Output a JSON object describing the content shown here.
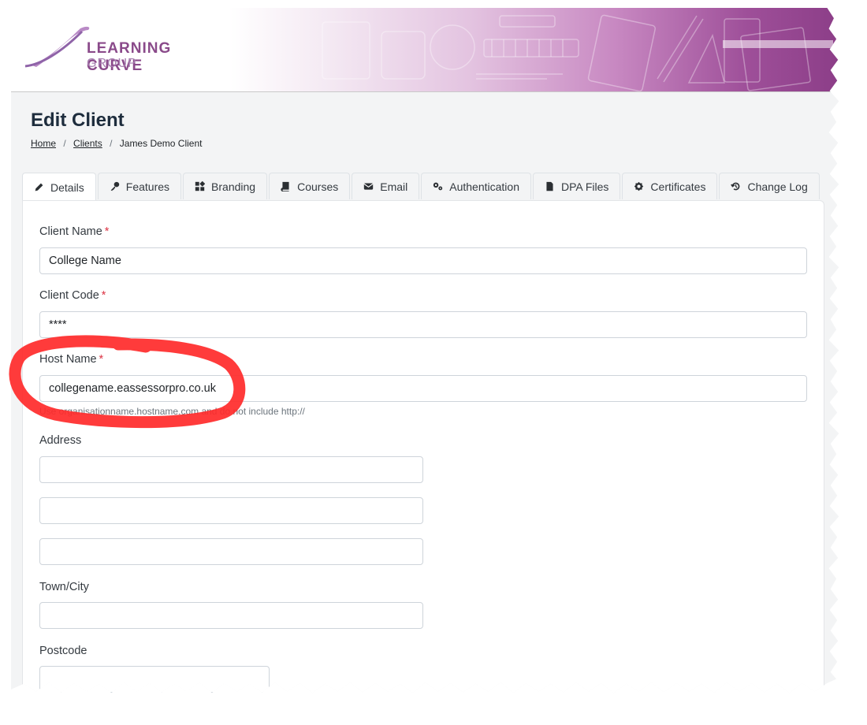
{
  "header": {
    "logo_line1": "LEARNING CURVE",
    "logo_line2": "GROUP",
    "brand_color": "#8a3c86"
  },
  "page": {
    "title": "Edit Client"
  },
  "breadcrumb": {
    "home": "Home",
    "clients": "Clients",
    "current": "James Demo Client",
    "separator": "/"
  },
  "tabs": [
    {
      "label": "Details",
      "icon": "pencil-icon",
      "active": true
    },
    {
      "label": "Features",
      "icon": "key-icon"
    },
    {
      "label": "Branding",
      "icon": "palette-icon"
    },
    {
      "label": "Courses",
      "icon": "book-icon"
    },
    {
      "label": "Email",
      "icon": "envelope-icon"
    },
    {
      "label": "Authentication",
      "icon": "gears-icon"
    },
    {
      "label": "DPA Files",
      "icon": "file-icon"
    },
    {
      "label": "Certificates",
      "icon": "certificate-icon"
    },
    {
      "label": "Change Log",
      "icon": "history-icon"
    }
  ],
  "form": {
    "required_marker": "*",
    "client_name": {
      "label": "Client Name",
      "value": "College Name"
    },
    "client_code": {
      "label": "Client Code",
      "value": "****"
    },
    "host_name": {
      "label": "Host Name",
      "value": "collegename.eassessorpro.co.uk",
      "help": "Use organisationname.hostname.com and do not include http://"
    },
    "address": {
      "label": "Address",
      "line1": "",
      "line2": "",
      "line3": ""
    },
    "town_city": {
      "label": "Town/City",
      "value": ""
    },
    "postcode": {
      "label": "Postcode",
      "value": ""
    }
  },
  "annotation_color": "#ff2a2a"
}
